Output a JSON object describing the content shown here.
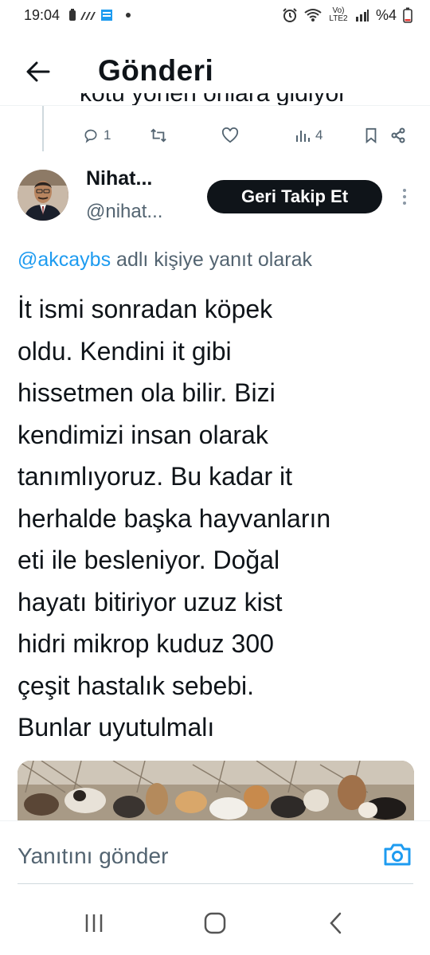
{
  "status_bar": {
    "time": "19:04",
    "network_label": "Vo) LTE2",
    "battery": "%4"
  },
  "header": {
    "title": "Gönderi"
  },
  "previous_tweet": {
    "cropped_text": "kötü yönen onlara gidiyor",
    "reply_count": "1",
    "views": "4"
  },
  "tweet": {
    "author_name": "Nihat...",
    "author_handle": "@nihat...",
    "follow_back_label": "Geri Takip Et",
    "reply_mention": "@akcaybs",
    "reply_suffix": " adlı kişiye yanıt olarak",
    "lines": [
      "İt ismi sonradan köpek",
      "oldu. Kendini it gibi",
      "hissetmen ola bilir. Bizi",
      "kendimizi insan olarak",
      "tanımlıyoruz. Bu kadar it",
      "herhalde başka hayvanların",
      "eti ile besleniyor. Doğal",
      "hayatı bitiriyor uzuz kist",
      "hidri mikrop kuduz 300",
      "çeşit hastalık sebebi.",
      "Bunlar uyutulmalı"
    ]
  },
  "reply_bar": {
    "placeholder": "Yanıtını gönder"
  },
  "colors": {
    "accent": "#1d9bf0",
    "text": "#0f1419",
    "muted": "#536471",
    "button": "#0f1419"
  },
  "icons": [
    "back-arrow-icon",
    "reply-icon",
    "retweet-icon",
    "like-icon",
    "views-icon",
    "bookmark-icon",
    "share-icon",
    "more-icon",
    "camera-icon",
    "recents-icon",
    "home-icon",
    "nav-back-icon"
  ]
}
